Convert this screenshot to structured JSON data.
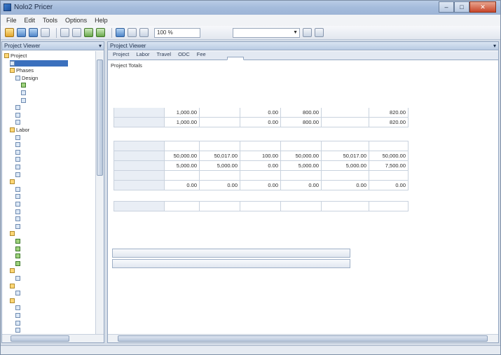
{
  "window": {
    "title": "Nolo2 Pricer"
  },
  "menu": [
    "File",
    "Edit",
    "Tools",
    "Options",
    "Help"
  ],
  "toolbar": {
    "zoom_value": "100 %",
    "mode_value": ""
  },
  "left_panel": {
    "title": "Project Viewer",
    "tree": [
      {
        "label": "Project",
        "level": 0,
        "icon": "folder"
      },
      {
        "label": "",
        "level": 1,
        "icon": "node",
        "selected": true
      },
      {
        "label": "Phases",
        "level": 1,
        "icon": "folder"
      },
      {
        "label": "Design",
        "level": 2,
        "icon": "node"
      },
      {
        "label": "",
        "level": 3,
        "icon": "green"
      },
      {
        "label": "",
        "level": 3,
        "icon": "node"
      },
      {
        "label": "",
        "level": 3,
        "icon": "node"
      },
      {
        "label": "",
        "level": 2,
        "icon": "node"
      },
      {
        "label": "",
        "level": 2,
        "icon": "node"
      },
      {
        "label": "",
        "level": 2,
        "icon": "node"
      },
      {
        "label": "Labor",
        "level": 1,
        "icon": "folder"
      },
      {
        "label": "",
        "level": 2,
        "icon": "node"
      },
      {
        "label": "",
        "level": 2,
        "icon": "node"
      },
      {
        "label": "",
        "level": 2,
        "icon": "node"
      },
      {
        "label": "",
        "level": 2,
        "icon": "node"
      },
      {
        "label": "",
        "level": 2,
        "icon": "node"
      },
      {
        "label": "",
        "level": 2,
        "icon": "node"
      },
      {
        "label": "",
        "level": 1,
        "icon": "folder"
      },
      {
        "label": "",
        "level": 2,
        "icon": "node"
      },
      {
        "label": "",
        "level": 2,
        "icon": "node"
      },
      {
        "label": "",
        "level": 2,
        "icon": "node"
      },
      {
        "label": "",
        "level": 2,
        "icon": "node"
      },
      {
        "label": "",
        "level": 2,
        "icon": "node"
      },
      {
        "label": "",
        "level": 2,
        "icon": "node"
      },
      {
        "label": "",
        "level": 1,
        "icon": "folder"
      },
      {
        "label": "",
        "level": 2,
        "icon": "green"
      },
      {
        "label": "",
        "level": 2,
        "icon": "green"
      },
      {
        "label": "",
        "level": 2,
        "icon": "green"
      },
      {
        "label": "",
        "level": 2,
        "icon": "green"
      },
      {
        "label": "",
        "level": 1,
        "icon": "folder"
      },
      {
        "label": "",
        "level": 2,
        "icon": "node"
      },
      {
        "label": "",
        "level": 1,
        "icon": "folder"
      },
      {
        "label": "",
        "level": 2,
        "icon": "node"
      },
      {
        "label": "",
        "level": 1,
        "icon": "folder"
      },
      {
        "label": "",
        "level": 2,
        "icon": "node"
      },
      {
        "label": "",
        "level": 2,
        "icon": "node"
      },
      {
        "label": "",
        "level": 2,
        "icon": "node"
      },
      {
        "label": "",
        "level": 2,
        "icon": "node"
      }
    ]
  },
  "right_panel": {
    "title": "Project Viewer",
    "tabs": [
      "Project",
      "Labor",
      "Travel",
      "ODC",
      "Fee",
      "",
      "",
      "",
      "",
      ""
    ],
    "active_tab": 6,
    "section": "Project Totals",
    "columns": [
      "",
      "",
      "",
      "",
      "",
      "",
      ""
    ],
    "hours_rows": [
      {
        "label": "",
        "values": [
          "1,000.00",
          "",
          "0.00",
          "800.00",
          "",
          "820.00"
        ]
      },
      {
        "label": "",
        "values": [
          "1,000.00",
          "",
          "0.00",
          "800.00",
          "",
          "820.00"
        ]
      }
    ],
    "cost_rows": [
      {
        "label": "",
        "values": [
          "",
          "",
          "",
          "",
          "",
          ""
        ]
      },
      {
        "label": "",
        "values": [
          "50,000.00",
          "50,017.00",
          "100.00",
          "50,000.00",
          "50,017.00",
          "50,000.00"
        ]
      },
      {
        "label": "",
        "values": [
          "5,000.00",
          "5,000.00",
          "0.00",
          "5,000.00",
          "5,000.00",
          "7,500.00"
        ]
      },
      {
        "label": "",
        "values": [
          "",
          "",
          "",
          "",
          "",
          ""
        ]
      },
      {
        "label": "",
        "values": [
          "0.00",
          "0.00",
          "0.00",
          "0.00",
          "0.00",
          "0.00"
        ]
      }
    ],
    "total_row": {
      "label": "",
      "values": [
        "",
        "",
        "",
        "",
        "",
        ""
      ]
    },
    "budget_label": "",
    "budget_buttons": [
      "",
      ""
    ]
  },
  "status": {
    "text": ""
  }
}
